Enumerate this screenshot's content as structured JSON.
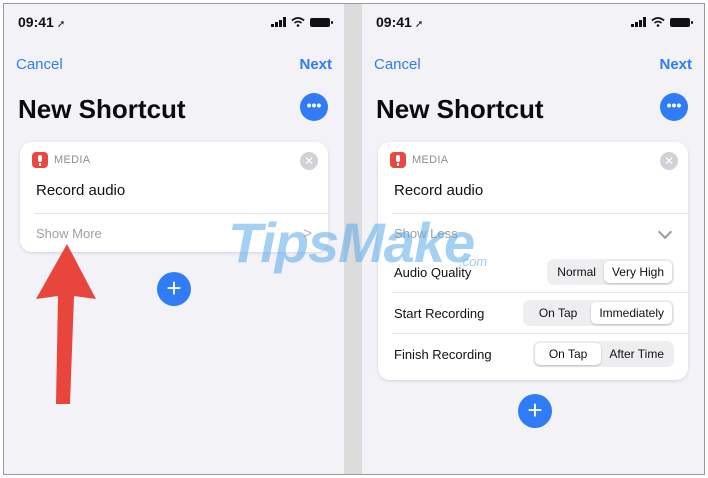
{
  "status": {
    "time": "09:41"
  },
  "nav": {
    "cancel": "Cancel",
    "next": "Next"
  },
  "page_title": "New Shortcut",
  "more_button": "•••",
  "action_card": {
    "category": "MEDIA",
    "action_name": "Record audio",
    "show_more": "Show More",
    "show_less": "Show Less"
  },
  "parameters": [
    {
      "label": "Audio Quality",
      "options": [
        "Normal",
        "Very High"
      ],
      "selected": "Very High"
    },
    {
      "label": "Start Recording",
      "options": [
        "On Tap",
        "Immediately"
      ],
      "selected": "Immediately"
    },
    {
      "label": "Finish Recording",
      "options": [
        "On Tap",
        "After Time"
      ],
      "selected": "On Tap"
    }
  ],
  "add_button": "+",
  "watermark": {
    "brand": "TipsMake",
    "suffix": ".com"
  },
  "colors": {
    "accent": "#2f7cf6",
    "annotation_arrow": "#e8453c",
    "mic_icon": "#e8483f"
  }
}
